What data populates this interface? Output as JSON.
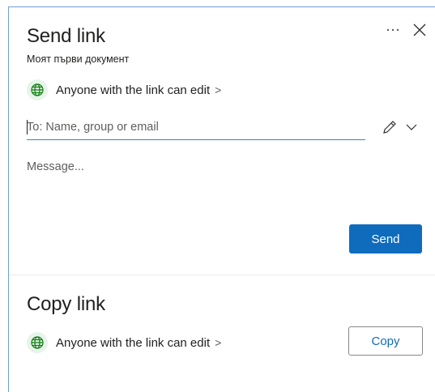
{
  "send": {
    "title": "Send link",
    "document_name": "Моят първи документ",
    "permission_label": "Anyone with the link can edit",
    "permission_chevron": ">",
    "to_placeholder": "To: Name, group or email",
    "message_placeholder": "Message...",
    "send_label": "Send"
  },
  "copy": {
    "title": "Copy link",
    "permission_label": "Anyone with the link can edit",
    "permission_chevron": ">",
    "copy_label": "Copy"
  },
  "icons": {
    "more": "more-options-icon",
    "close": "close-icon",
    "globe": "globe-icon",
    "pencil": "pencil-icon",
    "chevron": "chevron-down-icon"
  },
  "colors": {
    "accent": "#0f6cbd",
    "input_underline": "#2b88d8",
    "globe_bg": "#e6f4e9",
    "globe_stroke": "#107c10"
  }
}
